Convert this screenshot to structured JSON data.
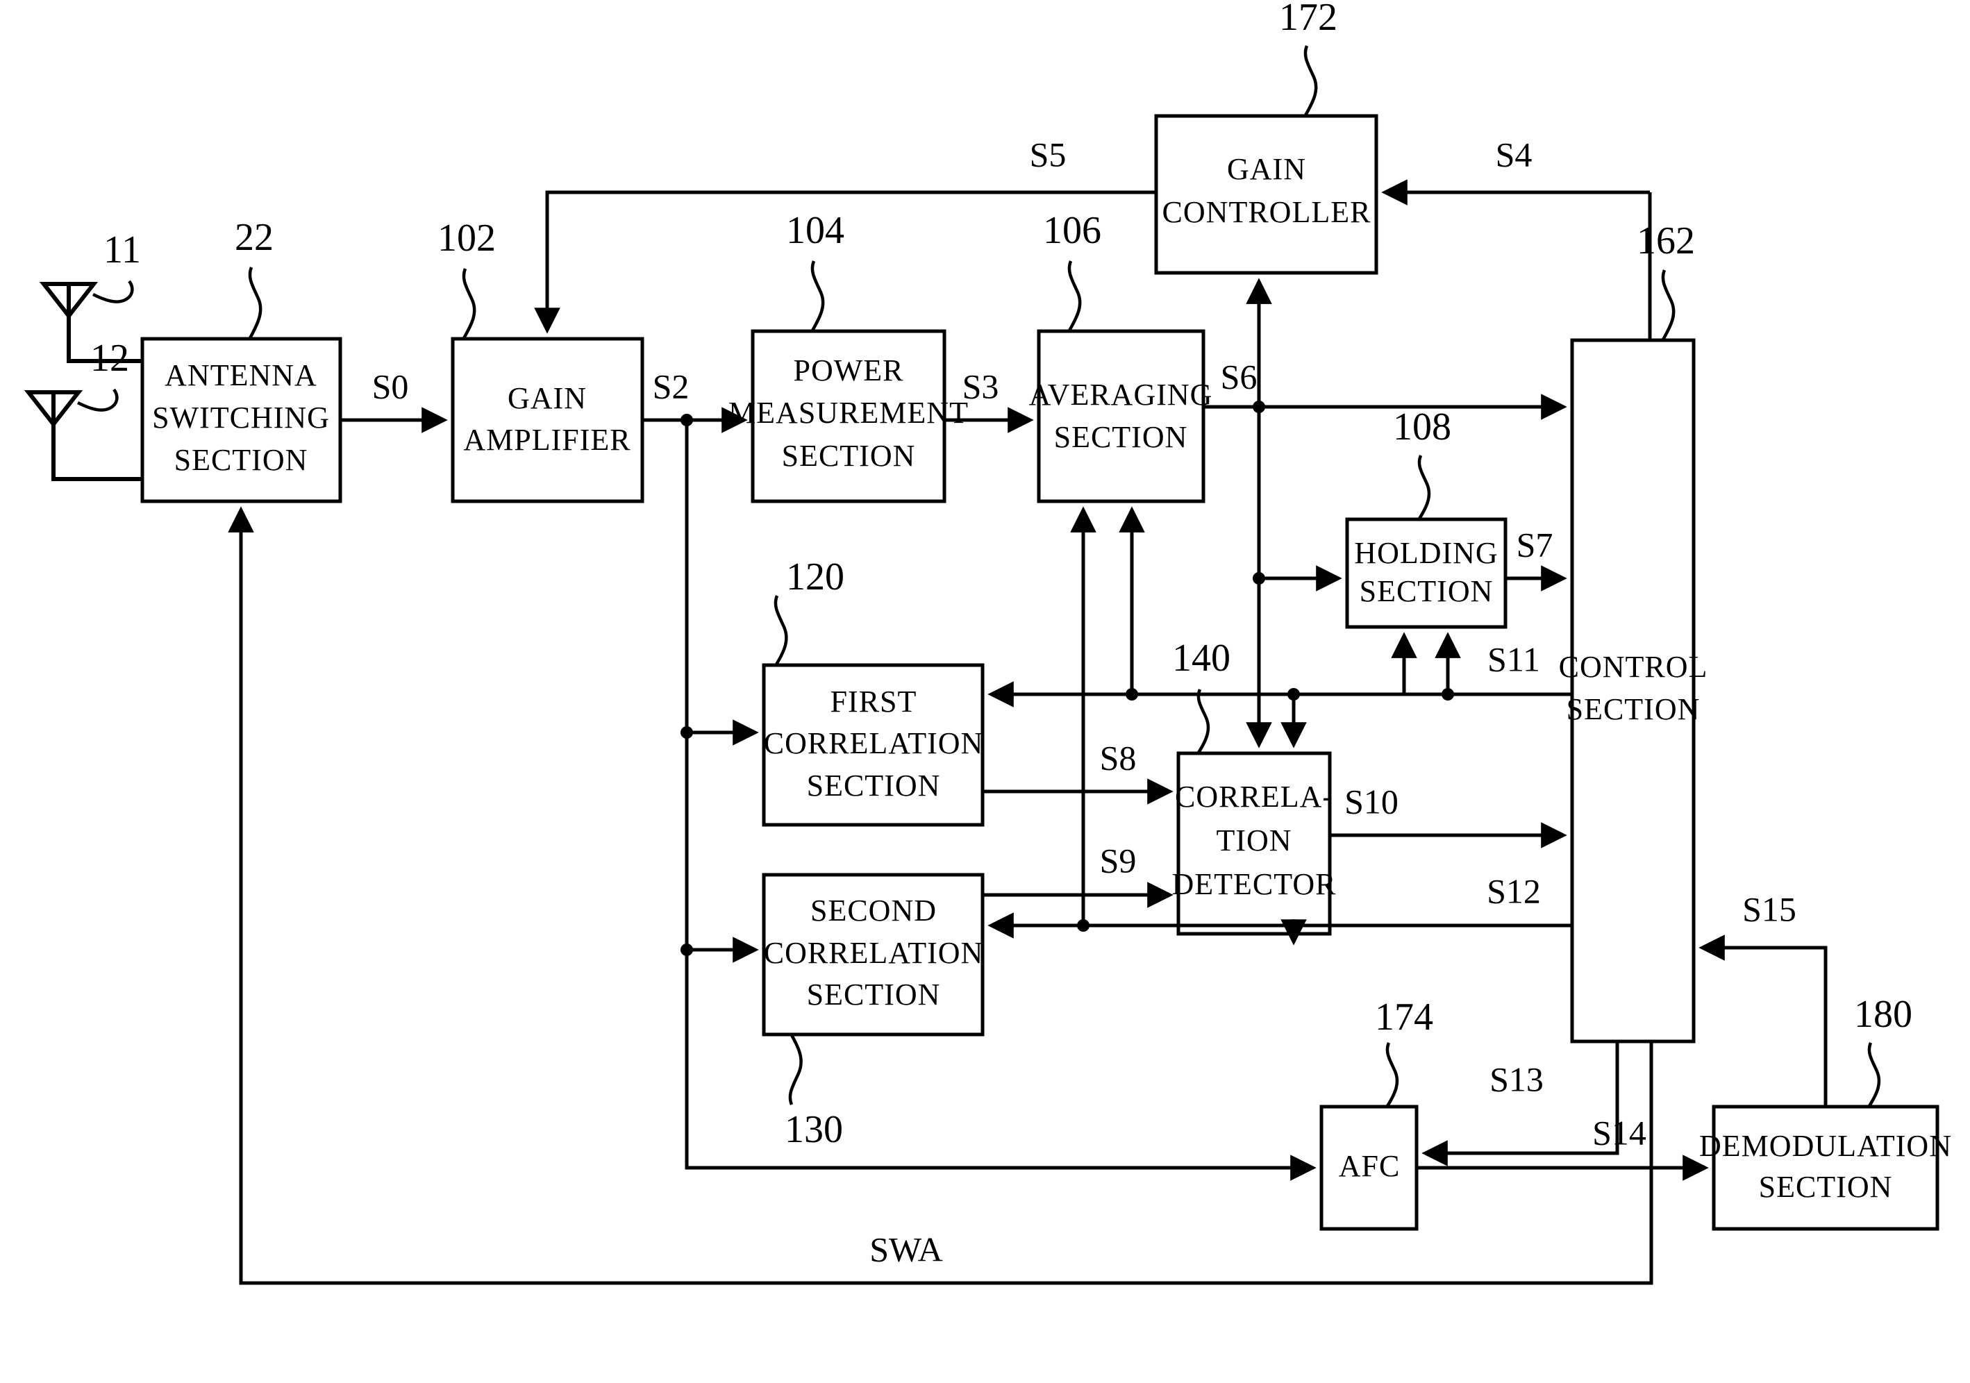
{
  "figure": {
    "type": "patent-block-diagram",
    "title": "Receiver block diagram with antenna switching, gain control, correlation and AFC"
  },
  "blocks": [
    {
      "id": "antenna_switching",
      "label_lines": [
        "ANTENNA",
        "SWITCHING",
        "SECTION"
      ],
      "ref": "22"
    },
    {
      "id": "gain_amplifier",
      "label_lines": [
        "GAIN",
        "AMPLIFIER"
      ],
      "ref": "102"
    },
    {
      "id": "power_measurement",
      "label_lines": [
        "POWER",
        "MEASUREMENT",
        "SECTION"
      ],
      "ref": "104"
    },
    {
      "id": "averaging",
      "label_lines": [
        "AVERAGING",
        "SECTION"
      ],
      "ref": "106"
    },
    {
      "id": "gain_controller",
      "label_lines": [
        "GAIN",
        "CONTROLLER"
      ],
      "ref": "172"
    },
    {
      "id": "holding",
      "label_lines": [
        "HOLDING",
        "SECTION"
      ],
      "ref": "108"
    },
    {
      "id": "control",
      "label_lines": [
        "CONTROL",
        "SECTION"
      ],
      "ref": "162"
    },
    {
      "id": "first_correlation",
      "label_lines": [
        "FIRST",
        "CORRELATION",
        "SECTION"
      ],
      "ref": "120"
    },
    {
      "id": "second_correlation",
      "label_lines": [
        "SECOND",
        "CORRELATION",
        "SECTION"
      ],
      "ref": "130"
    },
    {
      "id": "correlation_detector",
      "label_lines": [
        "CORRELA-",
        "TION",
        "DETECTOR"
      ],
      "ref": "140"
    },
    {
      "id": "afc",
      "label_lines": [
        "AFC"
      ],
      "ref": "174"
    },
    {
      "id": "demodulation",
      "label_lines": [
        "DEMODULATION",
        "SECTION"
      ],
      "ref": "180"
    }
  ],
  "antennas": [
    {
      "id": "antenna_1",
      "ref": "11"
    },
    {
      "id": "antenna_2",
      "ref": "12"
    }
  ],
  "signals": [
    {
      "id": "s0",
      "label": "S0"
    },
    {
      "id": "s2",
      "label": "S2"
    },
    {
      "id": "s3",
      "label": "S3"
    },
    {
      "id": "s4",
      "label": "S4"
    },
    {
      "id": "s5",
      "label": "S5"
    },
    {
      "id": "s6",
      "label": "S6"
    },
    {
      "id": "s7",
      "label": "S7"
    },
    {
      "id": "s8",
      "label": "S8"
    },
    {
      "id": "s9",
      "label": "S9"
    },
    {
      "id": "s10",
      "label": "S10"
    },
    {
      "id": "s11",
      "label": "S11"
    },
    {
      "id": "s12",
      "label": "S12"
    },
    {
      "id": "s13",
      "label": "S13"
    },
    {
      "id": "s14",
      "label": "S14"
    },
    {
      "id": "s15",
      "label": "S15"
    },
    {
      "id": "swa",
      "label": "SWA"
    }
  ],
  "refs": {
    "antenna_1": "11",
    "antenna_2": "12",
    "antenna_switching": "22",
    "gain_amplifier": "102",
    "power_measurement": "104",
    "averaging": "106",
    "holding": "108",
    "first_correlation": "120",
    "second_correlation": "130",
    "correlation_detector": "140",
    "control": "162",
    "gain_controller": "172",
    "afc": "174",
    "demodulation": "180"
  },
  "block_text": {
    "antenna_switching": {
      "l1": "ANTENNA",
      "l2": "SWITCHING",
      "l3": "SECTION"
    },
    "gain_amplifier": {
      "l1": "GAIN",
      "l2": "AMPLIFIER"
    },
    "power_measurement": {
      "l1": "POWER",
      "l2": "MEASUREMENT",
      "l3": "SECTION"
    },
    "averaging": {
      "l1": "AVERAGING",
      "l2": "SECTION"
    },
    "gain_controller": {
      "l1": "GAIN",
      "l2": "CONTROLLER"
    },
    "holding": {
      "l1": "HOLDING",
      "l2": "SECTION"
    },
    "control": {
      "l1": "CONTROL",
      "l2": "SECTION"
    },
    "first_correlation": {
      "l1": "FIRST",
      "l2": "CORRELATION",
      "l3": "SECTION"
    },
    "second_correlation": {
      "l1": "SECOND",
      "l2": "CORRELATION",
      "l3": "SECTION"
    },
    "correlation_detector": {
      "l1": "CORRELA-",
      "l2": "TION",
      "l3": "DETECTOR"
    },
    "afc": {
      "l1": "AFC"
    },
    "demodulation": {
      "l1": "DEMODULATION",
      "l2": "SECTION"
    }
  },
  "signal_text": {
    "s0": "S0",
    "s2": "S2",
    "s3": "S3",
    "s4": "S4",
    "s5": "S5",
    "s6": "S6",
    "s7": "S7",
    "s8": "S8",
    "s9": "S9",
    "s10": "S10",
    "s11": "S11",
    "s12": "S12",
    "s13": "S13",
    "s14": "S14",
    "s15": "S15",
    "swa": "SWA"
  },
  "colors": {
    "ink": "#000000",
    "paper": "#ffffff"
  }
}
